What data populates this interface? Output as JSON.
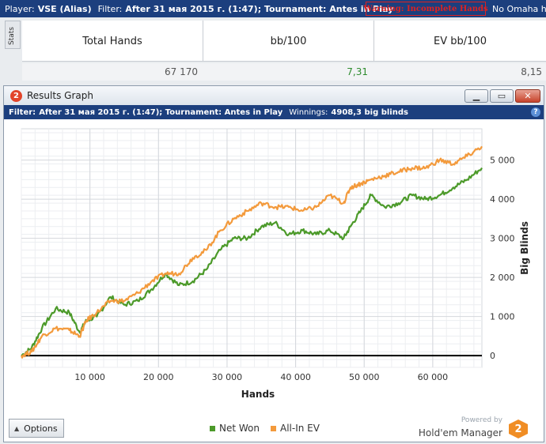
{
  "topbar": {
    "player_label": "Player:",
    "player_value": "VSE (Alias)",
    "filter_label": "Filter:",
    "filter_value": "After 31 мая 2015 г. (1:47); Tournament: Antes in Play",
    "warning": "Warning: Incomplete Hands",
    "game_filter": "No Omaha hai"
  },
  "stats": {
    "tab_label": "Stats",
    "headers": [
      "Total Hands",
      "bb/100",
      "EV bb/100"
    ],
    "values": [
      "67 170",
      "7,31",
      "8,15"
    ],
    "value_colors": [
      "#555555",
      "#2e8b2e",
      "#555555"
    ]
  },
  "window": {
    "title": "Results Graph",
    "logo_glyph": "2",
    "filter_label": "Filter:",
    "filter_value": "After 31 мая 2015 г. (1:47); Tournament: Antes in Play",
    "winnings_label": "Winnings:",
    "winnings_value": "4908,3 big blinds",
    "help_glyph": "?",
    "buttons": {
      "minimize": "minimize-icon",
      "maximize": "maximize-icon",
      "close": "close-icon"
    }
  },
  "bottom": {
    "options_label": "Options",
    "powered_by": "Powered by",
    "brand": "Hold'em Manager",
    "brand_glyph": "2"
  },
  "colors": {
    "net_won": "#4c9a2a",
    "all_in_ev": "#f39a3c",
    "accent_bar": "#1c3f7e"
  },
  "chart_data": {
    "type": "line",
    "xlabel": "Hands",
    "ylabel": "Big Blinds",
    "xlim": [
      0,
      67170
    ],
    "ylim": [
      -300,
      5800
    ],
    "xticks": [
      10000,
      20000,
      30000,
      40000,
      50000,
      60000
    ],
    "xtick_labels": [
      "10 000",
      "20 000",
      "30 000",
      "40 000",
      "50 000",
      "60 000"
    ],
    "yticks": [
      0,
      1000,
      2000,
      3000,
      4000,
      5000
    ],
    "ytick_labels": [
      "0",
      "1 000",
      "2 000",
      "3 000",
      "4 000",
      "5 000"
    ],
    "grid": true,
    "legend": "bottom",
    "series": [
      {
        "name": "Net Won",
        "color": "#4c9a2a",
        "x": [
          0,
          1500,
          3000,
          5000,
          7000,
          8500,
          9500,
          11000,
          13000,
          15000,
          17000,
          19000,
          21000,
          23000,
          25000,
          27000,
          29000,
          31000,
          33000,
          35000,
          37000,
          39000,
          41000,
          43000,
          45000,
          47000,
          48000,
          49500,
          51000,
          53000,
          55000,
          57000,
          59000,
          61000,
          63000,
          65000,
          67170
        ],
        "y": [
          0,
          200,
          700,
          1200,
          1100,
          600,
          900,
          1000,
          1500,
          1300,
          1400,
          1700,
          2100,
          1800,
          1900,
          2200,
          2700,
          3000,
          3000,
          3300,
          3400,
          3100,
          3200,
          3100,
          3200,
          3000,
          3300,
          3700,
          4100,
          3800,
          3900,
          4100,
          4000,
          4100,
          4300,
          4500,
          4800
        ]
      },
      {
        "name": "All-In EV",
        "color": "#f39a3c",
        "x": [
          0,
          1500,
          3000,
          5000,
          7000,
          8500,
          9500,
          11000,
          13000,
          15000,
          17000,
          19000,
          21000,
          23000,
          25000,
          27000,
          29000,
          31000,
          33000,
          35000,
          37000,
          39000,
          41000,
          43000,
          45000,
          47000,
          48000,
          49500,
          51000,
          53000,
          55000,
          57000,
          59000,
          61000,
          63000,
          65000,
          67170
        ],
        "y": [
          0,
          100,
          500,
          700,
          650,
          500,
          900,
          1100,
          1400,
          1400,
          1600,
          1900,
          2100,
          2100,
          2500,
          2700,
          3200,
          3500,
          3700,
          3900,
          3800,
          3800,
          3700,
          3800,
          4100,
          3900,
          4300,
          4400,
          4500,
          4600,
          4700,
          4800,
          4800,
          5000,
          4900,
          5100,
          5350
        ]
      }
    ]
  }
}
